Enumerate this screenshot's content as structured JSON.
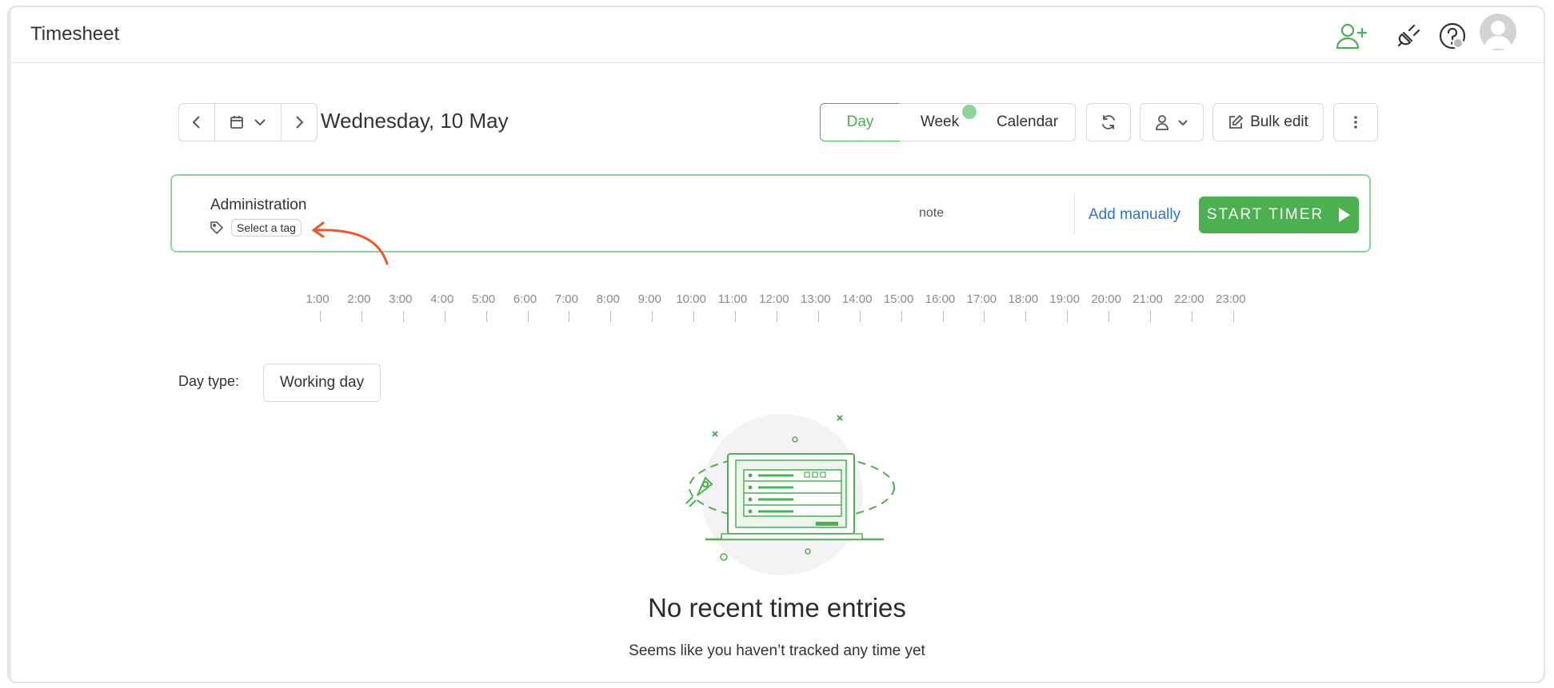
{
  "header": {
    "title": "Timesheet",
    "icons": [
      "add-user-icon",
      "plug-icon",
      "help-icon",
      "avatar"
    ]
  },
  "toolbar": {
    "date": "Wednesday, 10 May",
    "views": [
      "Day",
      "Week",
      "Calendar"
    ],
    "active_view": "Day",
    "bulk_edit": "Bulk edit"
  },
  "entry": {
    "project": "Administration",
    "tag_placeholder": "Select a tag",
    "note": "note",
    "add_manually": "Add manually",
    "start_timer": "START TIMER"
  },
  "timeline": {
    "hours": [
      "1:00",
      "2:00",
      "3:00",
      "4:00",
      "5:00",
      "6:00",
      "7:00",
      "8:00",
      "9:00",
      "10:00",
      "11:00",
      "12:00",
      "13:00",
      "14:00",
      "15:00",
      "16:00",
      "17:00",
      "18:00",
      "19:00",
      "20:00",
      "21:00",
      "22:00",
      "23:00"
    ]
  },
  "day_type": {
    "label": "Day type:",
    "value": "Working day"
  },
  "empty_state": {
    "title": "No recent time entries",
    "subtitle": "Seems like you haven’t tracked any time yet"
  },
  "colors": {
    "accent": "#4caf50",
    "accent_light": "#8fd49a",
    "link": "#2f72d6",
    "annotation_arrow": "#e8592d"
  }
}
